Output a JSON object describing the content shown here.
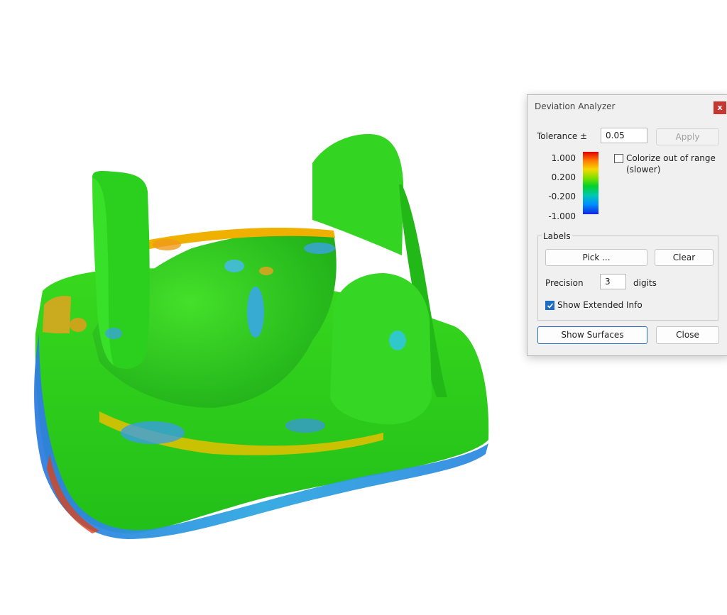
{
  "dialog": {
    "title": "Deviation Analyzer",
    "close_glyph": "x",
    "tolerance_label": "Tolerance ±",
    "tolerance_value": "0.05",
    "apply_label": "Apply",
    "scale_ticks": [
      "1.000",
      "0.200",
      "-0.200",
      "-1.000"
    ],
    "colorize_label_line1": "Colorize out of range",
    "colorize_label_line2": "(slower)",
    "colorize_checked": false,
    "labels_group_title": "Labels",
    "pick_label": "Pick ...",
    "clear_label": "Clear",
    "precision_label": "Precision",
    "precision_value": "3",
    "digits_label": "digits",
    "extended_info_label": "Show Extended Info",
    "extended_info_checked": true,
    "show_surfaces_label": "Show Surfaces",
    "close_label": "Close"
  },
  "scale_colors": [
    "#e30000",
    "#f5d800",
    "#00d22a",
    "#0090ff",
    "#1025e0"
  ],
  "model": {
    "description_icon": "deviation-colormap-3d-model"
  }
}
